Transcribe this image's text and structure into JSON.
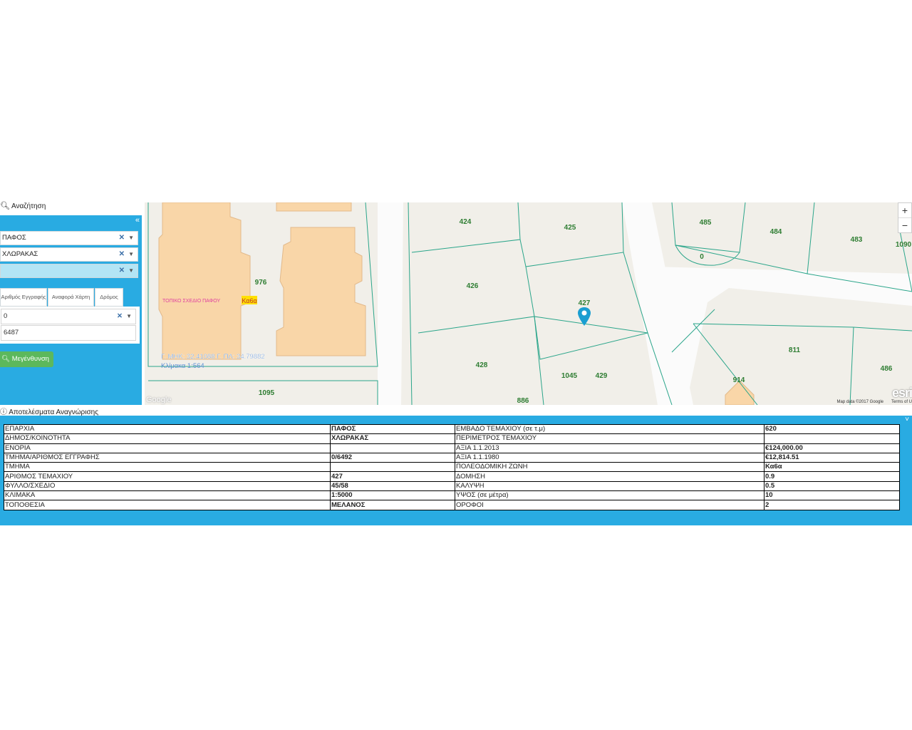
{
  "search": {
    "title": "Αναζήτηση",
    "collapse_icon": "«"
  },
  "filters": {
    "district": "ΠΑΦΟΣ",
    "municipality": "ΧΛΩΡΑΚΑΣ",
    "third": ""
  },
  "tabs": [
    "Αριθμός Εγγραφής",
    "Αναφορά Χάρτη",
    "Δρόμος"
  ],
  "registration": {
    "block": "0",
    "number": "6487"
  },
  "zoom_button": "Μεγένθυνση",
  "map": {
    "parcels": [
      "424",
      "425",
      "426",
      "427",
      "428",
      "429",
      "1045",
      "886",
      "976",
      "1095",
      "485",
      "484",
      "483",
      "1090",
      "0",
      "811",
      "914",
      "486"
    ],
    "plan_label": "ΤΟΠΙΚΟ ΣΧΕΔΙΟ ΠΑΦΟΥ",
    "zone_label": "Κα6α",
    "coords": "Γ. ΜΗΚ: 32.41088 Γ. ΠΛ: 34.79882",
    "scale": "Κλίμακα 1:564",
    "attribution": "Map data ©2017 Google",
    "terms": "Terms of U",
    "esri": "esri",
    "google": "Google",
    "zoom_in": "+",
    "zoom_out": "−",
    "marker_color": "#1a9ed1"
  },
  "results": {
    "title": "Αποτελέσματα Αναγνώρισης",
    "collapse_icon": "˅",
    "rows": [
      [
        "ΕΠΑΡΧΙΑ",
        "ΠΑΦΟΣ",
        "ΕΜΒΑΔΟ ΤΕΜΑΧΙΟΥ (σε τ.μ)",
        "620"
      ],
      [
        "ΔΗΜΟΣ/ΚΟΙΝΟΤΗΤΑ",
        "ΧΛΩΡΑΚΑΣ",
        "ΠΕΡΙΜΕΤΡΟΣ ΤΕΜΑΧΙΟΥ",
        ""
      ],
      [
        "ΕΝΟΡΙΑ",
        "",
        "ΑΞΙΑ 1.1.2013",
        "€124,000.00"
      ],
      [
        "ΤΜΗΜΑ/ΑΡΙΘΜΟΣ ΕΓΓΡΑΦΗΣ",
        "0/6492",
        "ΑΞΙΑ 1.1.1980",
        "€12,814.51"
      ],
      [
        "ΤΜΗΜΑ",
        "",
        "ΠΟΛΕΟΔΟΜΙΚΗ ΖΩΝΗ",
        "Κα6α"
      ],
      [
        "ΑΡΙΘΜΟΣ ΤΕΜΑΧΙΟΥ",
        "427",
        "ΔΟΜΗΣΗ",
        "0.9"
      ],
      [
        "ΦΥΛΛΟ/ΣΧΕΔΙΟ",
        "45/58",
        "ΚΑΛΥΨΗ",
        "0.5"
      ],
      [
        "ΚΛΙΜΑΚΑ",
        "1:5000",
        "ΥΨΟΣ (σε μέτρα)",
        "10"
      ],
      [
        "ΤΟΠΟΘΕΣΙΑ",
        "ΜΕΛΑΝΟΣ",
        "ΟΡΟΦΟΙ",
        "2"
      ]
    ]
  },
  "colors": {
    "accent": "#29abe2",
    "button": "#5cb85c",
    "parcel_line": "#2aa58a",
    "parcel_text": "#2e7d32",
    "building": "#f9d6a8"
  }
}
